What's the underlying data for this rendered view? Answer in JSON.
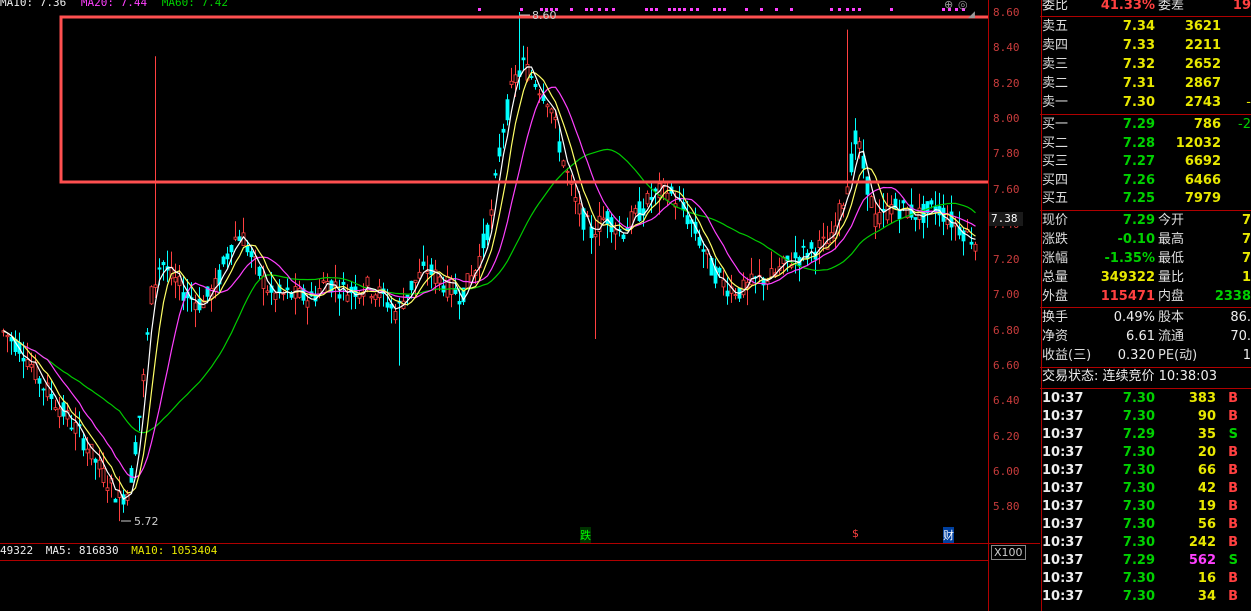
{
  "legend": {
    "ma10": "MA10: 7.36",
    "ma20": "MA20: 7.44",
    "ma60": "MA60: 7.42"
  },
  "price_axis": {
    "ticks": [
      "8.60",
      "8.40",
      "8.20",
      "8.00",
      "7.80",
      "7.60",
      "7.40",
      "7.20",
      "7.00",
      "6.80",
      "6.60",
      "6.40",
      "6.20",
      "6.00",
      "5.80"
    ],
    "current": "7.38"
  },
  "annotations": {
    "high": "8.60",
    "low": "5.72"
  },
  "markers": {
    "m1": "跌",
    "m2": "$",
    "m3": "财"
  },
  "volume": {
    "legend_tail": "49322",
    "ma5": "MA5: 816830",
    "ma10": "MA10: 1053404",
    "unit": "X100"
  },
  "colors": {
    "up": "#ff4040",
    "down": "#00ffff",
    "ma5": "#ffffff",
    "ma10": "#ffff00",
    "ma20": "#ff40ff",
    "ma60": "#00cc00",
    "highlight": "#ff5050"
  },
  "quote": {
    "weibi_label": "委比",
    "weibi_val": "41.33%",
    "weicha_label": "委差",
    "weicha_val": "19",
    "sell": [
      {
        "label": "卖五",
        "price": "7.34",
        "vol": "3621"
      },
      {
        "label": "卖四",
        "price": "7.33",
        "vol": "2211"
      },
      {
        "label": "卖三",
        "price": "7.32",
        "vol": "2652"
      },
      {
        "label": "卖二",
        "price": "7.31",
        "vol": "2867"
      },
      {
        "label": "卖一",
        "price": "7.30",
        "vol": "2743",
        "extra": "-"
      }
    ],
    "buy": [
      {
        "label": "买一",
        "price": "7.29",
        "vol": "786",
        "extra": "-2"
      },
      {
        "label": "买二",
        "price": "7.28",
        "vol": "12032"
      },
      {
        "label": "买三",
        "price": "7.27",
        "vol": "6692"
      },
      {
        "label": "买四",
        "price": "7.26",
        "vol": "6466"
      },
      {
        "label": "买五",
        "price": "7.25",
        "vol": "7979"
      }
    ],
    "stats": [
      {
        "l1": "现价",
        "v1": "7.29",
        "l2": "今开",
        "v2": "7"
      },
      {
        "l1": "涨跌",
        "v1": "-0.10",
        "l2": "最高",
        "v2": "7"
      },
      {
        "l1": "涨幅",
        "v1": "-1.35%",
        "l2": "最低",
        "v2": "7"
      },
      {
        "l1": "总量",
        "v1": "349322",
        "l2": "量比",
        "v2": "1"
      },
      {
        "l1": "外盘",
        "v1": "115471",
        "l2": "内盘",
        "v2": "2338"
      }
    ],
    "stats2": [
      {
        "l1": "换手",
        "v1": "0.49%",
        "l2": "股本",
        "v2": "86."
      },
      {
        "l1": "净资",
        "v1": "6.61",
        "l2": "流通",
        "v2": "70."
      },
      {
        "l1": "收益(三)",
        "v1": "0.320",
        "l2": "PE(动)",
        "v2": "1"
      }
    ],
    "trade_status": "交易状态: 连续竞价 10:38:03",
    "ticks": [
      {
        "t": "10:37",
        "p": "7.30",
        "v": "383",
        "s": "B"
      },
      {
        "t": "10:37",
        "p": "7.30",
        "v": "90",
        "s": "B"
      },
      {
        "t": "10:37",
        "p": "7.29",
        "v": "35",
        "s": "S"
      },
      {
        "t": "10:37",
        "p": "7.30",
        "v": "20",
        "s": "B"
      },
      {
        "t": "10:37",
        "p": "7.30",
        "v": "66",
        "s": "B"
      },
      {
        "t": "10:37",
        "p": "7.30",
        "v": "42",
        "s": "B"
      },
      {
        "t": "10:37",
        "p": "7.30",
        "v": "19",
        "s": "B"
      },
      {
        "t": "10:37",
        "p": "7.30",
        "v": "56",
        "s": "B"
      },
      {
        "t": "10:37",
        "p": "7.30",
        "v": "242",
        "s": "B"
      },
      {
        "t": "10:37",
        "p": "7.29",
        "v": "562",
        "s": "S"
      },
      {
        "t": "10:37",
        "p": "7.30",
        "v": "16",
        "s": "B"
      },
      {
        "t": "10:37",
        "p": "7.30",
        "v": "34",
        "s": "B"
      }
    ]
  }
}
